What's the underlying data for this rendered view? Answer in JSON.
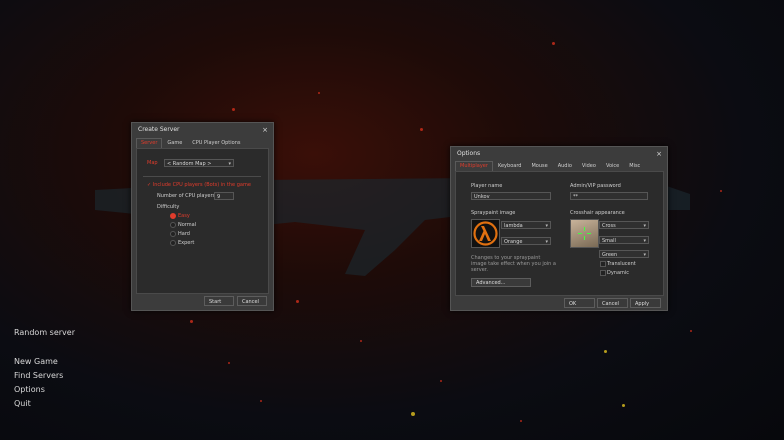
{
  "colors": {
    "accent": "#e03c2c",
    "window_bg": "#3c3c3c",
    "panel_bg": "#2b2b2b"
  },
  "main_menu": {
    "random_server": "Random server",
    "new_game": "New Game",
    "find_servers": "Find Servers",
    "options": "Options",
    "quit": "Quit"
  },
  "create_server": {
    "title": "Create Server",
    "close_icon": "×",
    "tabs": [
      "Server",
      "Game",
      "CPU Player Options"
    ],
    "map_label": "Map",
    "map_value": "< Random Map >",
    "include_cpu_label": "Include CPU players (Bots) in the game",
    "num_cpu_label": "Number of CPU players",
    "num_cpu_value": "9",
    "difficulty_label": "Difficulty",
    "difficulty_options": [
      "Easy",
      "Normal",
      "Hard",
      "Expert"
    ],
    "start_button": "Start",
    "cancel_button": "Cancel"
  },
  "options": {
    "title": "Options",
    "close_icon": "×",
    "tabs": [
      "Multiplayer",
      "Keyboard",
      "Mouse",
      "Audio",
      "Video",
      "Voice",
      "Misc"
    ],
    "player_name_label": "Player name",
    "player_name_value": "Unkov",
    "admin_password_label": "Admin/VIP password",
    "admin_password_value": "**",
    "spraypaint_label": "Spraypaint image",
    "spray_image_value": "lambda",
    "spray_color_value": "Orange",
    "spray_note": "Changes to your spraypaint image take effect when you join a server.",
    "advanced_button": "Advanced...",
    "crosshair_label": "Crosshair appearance",
    "crosshair_type_value": "Cross",
    "crosshair_size_value": "Small",
    "crosshair_color_value": "Green",
    "translucent_label": "Translucent",
    "dynamic_label": "Dynamic",
    "ok_button": "OK",
    "cancel_button": "Cancel",
    "apply_button": "Apply"
  }
}
